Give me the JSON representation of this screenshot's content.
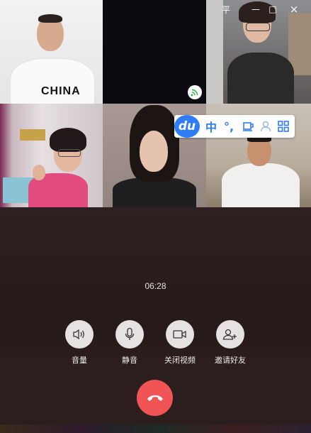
{
  "window": {
    "controls": {
      "pin": "平",
      "minimize": "—",
      "maximize": "□",
      "close": "×"
    }
  },
  "participants": [
    {
      "name_icon": "participant-1",
      "shirt_text": "CHINA"
    },
    {
      "name_icon": "participant-2",
      "badge_icon": "speaking-icon"
    },
    {
      "name_icon": "participant-3"
    },
    {
      "name_icon": "participant-4"
    },
    {
      "name_icon": "participant-5"
    },
    {
      "name_icon": "participant-6"
    }
  ],
  "ime_toolbar": {
    "logo": "du",
    "lang": "中",
    "punct": "°,",
    "items": [
      "cup-icon",
      "user-icon",
      "grid-icon"
    ]
  },
  "call": {
    "timer": "06:28",
    "controls": [
      {
        "label": "音量",
        "icon": "volume-icon"
      },
      {
        "label": "静音",
        "icon": "microphone-icon"
      },
      {
        "label": "关闭视频",
        "icon": "video-camera-icon"
      },
      {
        "label": "邀请好友",
        "icon": "add-person-icon"
      }
    ],
    "hangup_icon": "phone-hangup-icon"
  },
  "colors": {
    "hangup": "#f05455",
    "ime_blue": "#2f7df6",
    "control_circle": "#e6e2e2"
  }
}
